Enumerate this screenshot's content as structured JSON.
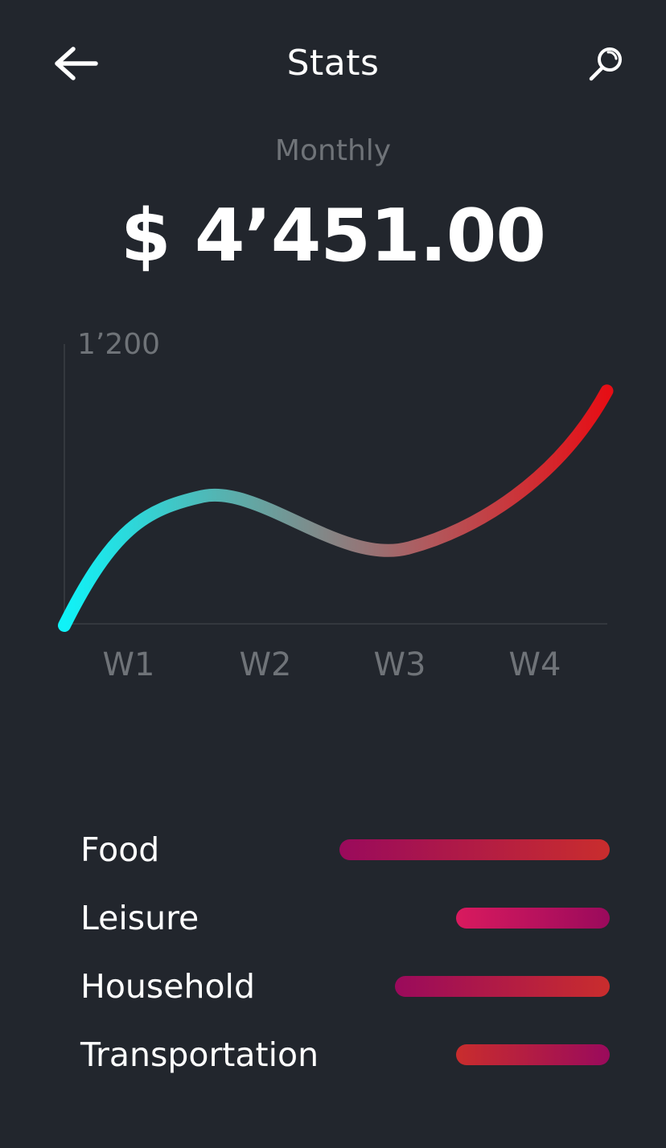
{
  "header": {
    "title": "Stats",
    "back_icon": "arrow-left-icon",
    "search_icon": "search-icon"
  },
  "summary": {
    "period": "Monthly",
    "total": "$ 4’451.00"
  },
  "chart_data": {
    "type": "line",
    "title": "",
    "xlabel": "",
    "ylabel": "",
    "categories": [
      "W1",
      "W2",
      "W3",
      "W4"
    ],
    "y_tick_label": "1’200",
    "ylim": [
      0,
      1200
    ],
    "grid": false,
    "series": [
      {
        "x": [
          0,
          0.9,
          2.25,
          3.55
        ],
        "y": [
          0,
          550,
          330,
          1000
        ]
      }
    ],
    "gradient_colors": [
      "#0ff3f8",
      "#60a9a6",
      "#b05a5e",
      "#e60e15"
    ]
  },
  "categories": [
    {
      "name": "Food",
      "share": 0.58,
      "colors": [
        "#9a0a5c",
        "#c92d2d"
      ]
    },
    {
      "name": "Leisure",
      "share": 0.33,
      "colors": [
        "#d91a5e",
        "#9a0a5c"
      ]
    },
    {
      "name": "Household",
      "share": 0.46,
      "colors": [
        "#9a0a5c",
        "#c92d2d"
      ]
    },
    {
      "name": "Transportation",
      "share": 0.33,
      "colors": [
        "#c92d2d",
        "#9a0a5c"
      ]
    }
  ],
  "colors": {
    "background": "#22262d",
    "muted_text": "#6f7378"
  }
}
